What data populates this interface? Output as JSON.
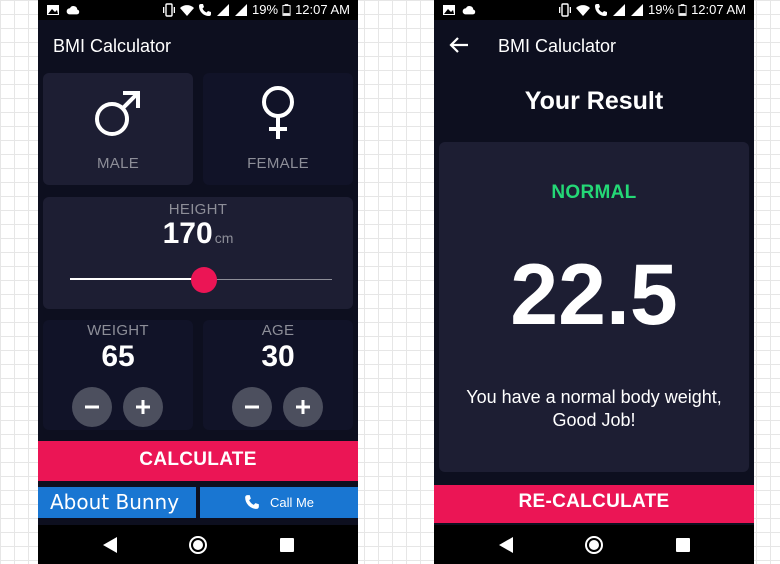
{
  "status_bar": {
    "battery_percent": "19%",
    "time": "12:07 AM",
    "icons": [
      "image-icon",
      "cloud-icon",
      "vibrate-icon",
      "wifi-icon",
      "call-icon",
      "signal-icon",
      "signal-icon",
      "battery-icon"
    ]
  },
  "input_screen": {
    "title": "BMI Calculator",
    "gender": {
      "male_label": "MALE",
      "female_label": "FEMALE",
      "selected": "male"
    },
    "height": {
      "label": "HEIGHT",
      "value": "170",
      "unit": "cm",
      "slider_fraction": 0.51
    },
    "weight": {
      "label": "WEIGHT",
      "value": "65"
    },
    "age": {
      "label": "AGE",
      "value": "30"
    },
    "calculate_label": "CALCULATE",
    "about_label": "About Bunny",
    "call_label": "Call Me"
  },
  "result_screen": {
    "title": "BMI Caluclator",
    "heading": "Your Result",
    "status": "NORMAL",
    "bmi": "22.5",
    "message": "You have a normal body weight, Good Job!",
    "recalculate_label": "RE-CALCULATE"
  },
  "colors": {
    "background": "#0d0f1f",
    "card": "#1d1e33",
    "accent": "#eb1555",
    "normal_green": "#24d876",
    "link_blue": "#1976d2",
    "label_grey": "#8d8e98"
  }
}
